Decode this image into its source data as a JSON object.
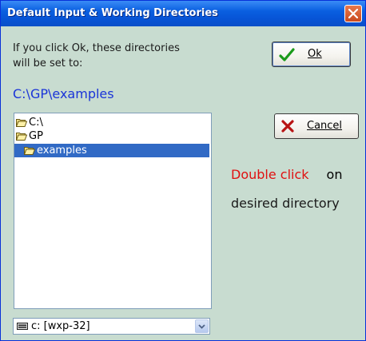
{
  "window": {
    "title": "Default Input & Working Directories"
  },
  "intro": {
    "line1": "If you click Ok, these directories",
    "line2": "will be set to:"
  },
  "selected_path": "C:\\GP\\examples",
  "buttons": {
    "ok_label": "Ok",
    "cancel_label": "Cancel"
  },
  "hint": {
    "red_text": "Double click",
    "after_red": "on",
    "line2": "desired directory"
  },
  "tree": {
    "items": [
      {
        "label": "C:\\",
        "icon": "folder-open-icon",
        "selected": false
      },
      {
        "label": "GP",
        "icon": "folder-open-icon",
        "selected": false
      },
      {
        "label": "examples",
        "icon": "folder-open-icon",
        "selected": true
      }
    ]
  },
  "drive": {
    "value": "c: [wxp-32]",
    "icon": "drive-icon"
  },
  "colors": {
    "title_bar": "#0754d6",
    "background": "#c8dcd0",
    "path_text": "#1a34d8",
    "hint_red": "#e01010",
    "selection": "#316ac5"
  }
}
